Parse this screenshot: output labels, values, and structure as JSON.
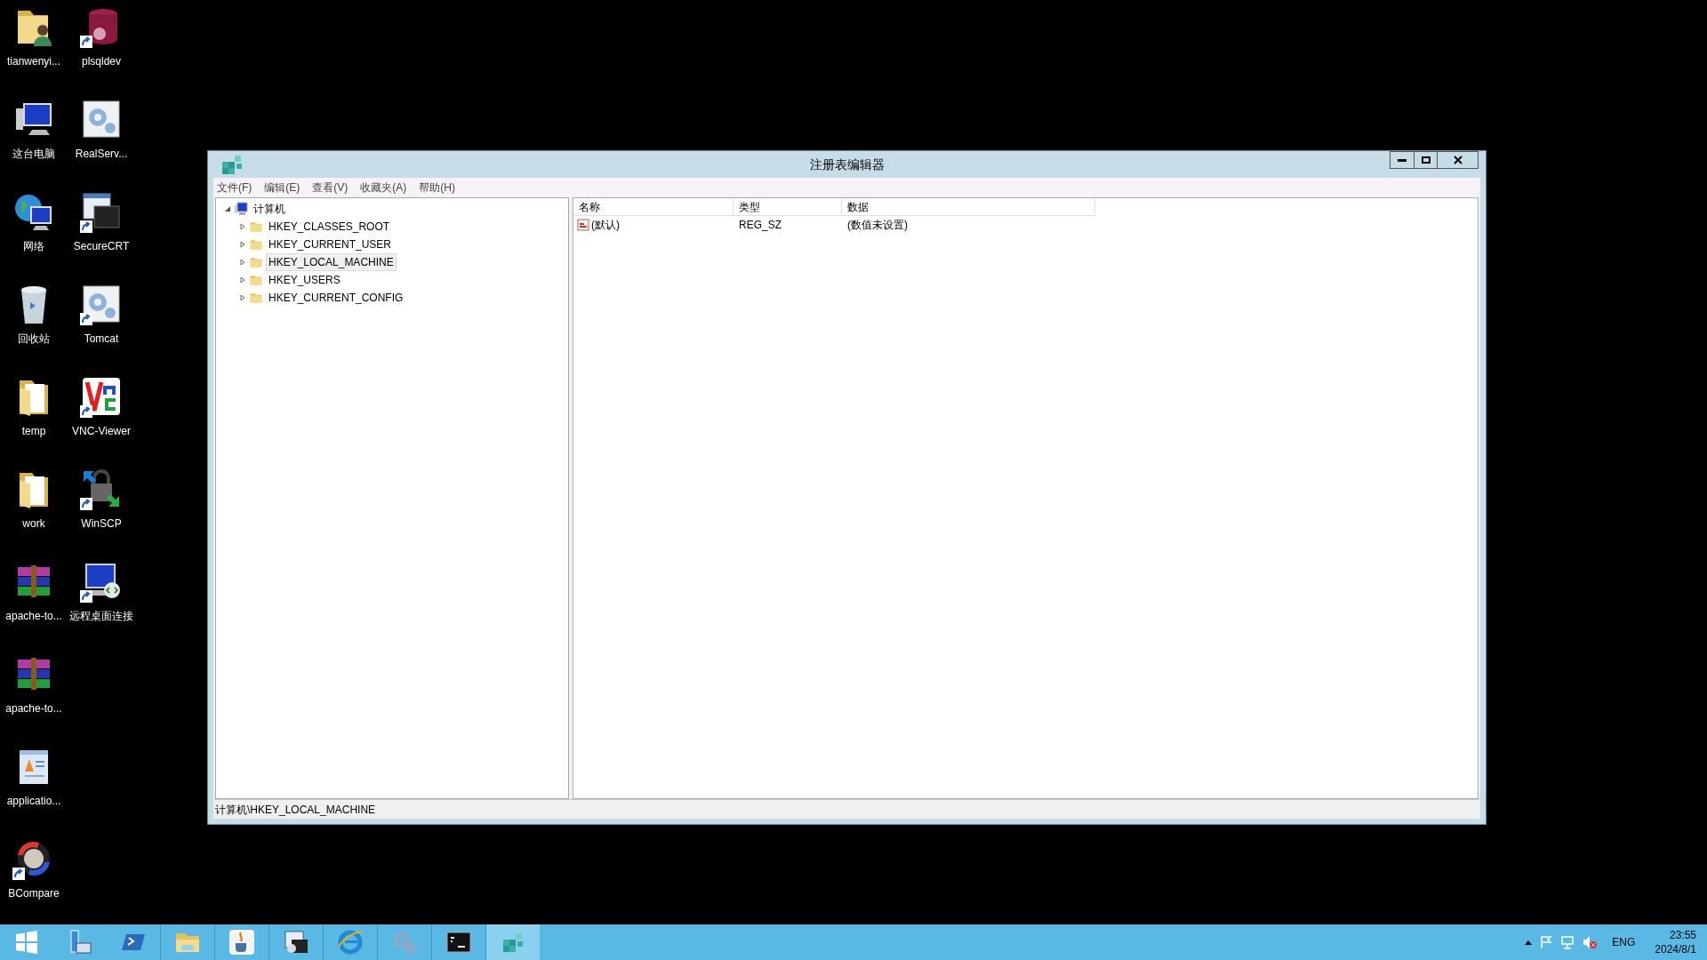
{
  "desktop_icons": [
    {
      "label": "tianwenyi...",
      "kind": "user-folder",
      "shortcut": false
    },
    {
      "label": "这台电脑",
      "kind": "computer",
      "shortcut": false
    },
    {
      "label": "网络",
      "kind": "network",
      "shortcut": false
    },
    {
      "label": "回收站",
      "kind": "recycle",
      "shortcut": false
    },
    {
      "label": "temp",
      "kind": "folder",
      "shortcut": false
    },
    {
      "label": "work",
      "kind": "folder",
      "shortcut": false
    },
    {
      "label": "apache-to...",
      "kind": "archive",
      "shortcut": false
    },
    {
      "label": "apache-to...",
      "kind": "archive",
      "shortcut": false
    },
    {
      "label": "applicatio...",
      "kind": "document",
      "shortcut": false
    },
    {
      "label": "BCompare",
      "kind": "compare",
      "shortcut": true
    },
    {
      "label": "plsqldev",
      "kind": "database",
      "shortcut": true
    },
    {
      "label": "RealServ...",
      "kind": "gear",
      "shortcut": false
    },
    {
      "label": "SecureCRT",
      "kind": "terminal",
      "shortcut": true
    },
    {
      "label": "Tomcat",
      "kind": "gear",
      "shortcut": true
    },
    {
      "label": "VNC-Viewer",
      "kind": "vnc",
      "shortcut": true
    },
    {
      "label": "WinSCP",
      "kind": "lock",
      "shortcut": true
    },
    {
      "label": "远程桌面连接",
      "kind": "remote",
      "shortcut": true
    }
  ],
  "window": {
    "title": "注册表编辑器",
    "menu": [
      "文件(F)",
      "编辑(E)",
      "查看(V)",
      "收藏夹(A)",
      "帮助(H)"
    ],
    "tree": [
      {
        "label": "计算机",
        "expanded": true,
        "selected": false,
        "children": [
          {
            "label": "HKEY_CLASSES_ROOT",
            "expanded": false,
            "selected": false
          },
          {
            "label": "HKEY_CURRENT_USER",
            "expanded": false,
            "selected": false
          },
          {
            "label": "HKEY_LOCAL_MACHINE",
            "expanded": false,
            "selected": true
          },
          {
            "label": "HKEY_USERS",
            "expanded": false,
            "selected": false
          },
          {
            "label": "HKEY_CURRENT_CONFIG",
            "expanded": false,
            "selected": false
          }
        ]
      }
    ],
    "table": {
      "columns": [
        "名称",
        "类型",
        "数据"
      ],
      "rows": [
        {
          "name": "(默认)",
          "type": "REG_SZ",
          "data": "(数值未设置)"
        }
      ]
    },
    "status_bar": "计算机\\HKEY_LOCAL_MACHINE"
  },
  "taskbar": {
    "buttons": [
      {
        "kind": "start",
        "selected": false
      },
      {
        "kind": "server",
        "selected": false
      },
      {
        "kind": "shell",
        "selected": false
      },
      {
        "kind": "explorer",
        "selected": false
      },
      {
        "kind": "java",
        "selected": false
      },
      {
        "kind": "terminal",
        "selected": false
      },
      {
        "kind": "browser",
        "selected": false
      },
      {
        "kind": "gear",
        "selected": false
      },
      {
        "kind": "console",
        "selected": false
      },
      {
        "kind": "registry",
        "selected": true
      }
    ],
    "language": "ENG",
    "time": "23:55",
    "date": "2024/8/1"
  }
}
